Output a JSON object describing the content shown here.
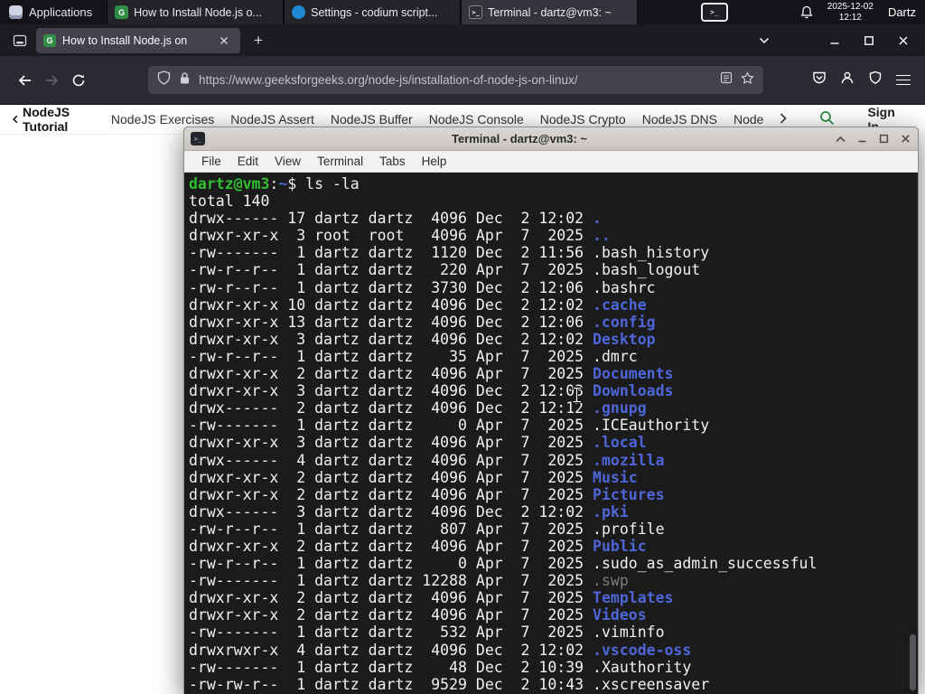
{
  "colors": {
    "panel_bg": "#141418",
    "tabstrip_bg": "#1c1b22",
    "navbar_bg": "#2b2a33",
    "urlbar_bg": "#42414d",
    "gfg_green": "#2f8d46",
    "term_bg": "#1b1b1b",
    "term_fg": "#f1f1f1",
    "term_green": "#2fbe2f",
    "term_blue": "#4e66d8",
    "term_dim": "#7d7d7d"
  },
  "taskbar": {
    "applications": "Applications",
    "windows": [
      {
        "title": "How to Install Node.js o...",
        "icon": "gfg",
        "active": false
      },
      {
        "title": "Settings - codium script...",
        "icon": "codium",
        "active": false
      },
      {
        "title": "Terminal - dartz@vm3: ~",
        "icon": "terminal",
        "active": true
      }
    ],
    "date": "2025-12-02",
    "time": "12:12",
    "user": "Dartz"
  },
  "icons": {
    "tray_terminal_glyph": ">_",
    "terminal_title_glyph": ">_",
    "gfg_glyph": "G",
    "new_tab_glyph": "+"
  },
  "browser": {
    "tab_title": "How to Install Node.js on",
    "url": "https://www.geeksforgeeks.org/node-js/installation-of-node-js-on-linux/",
    "site_nav": {
      "back_item": "NodeJS Tutorial",
      "items": [
        "NodeJS Exercises",
        "NodeJS Assert",
        "NodeJS Buffer",
        "NodeJS Console",
        "NodeJS Crypto",
        "NodeJS DNS",
        "Node"
      ],
      "sign_in": "Sign In"
    }
  },
  "terminal": {
    "window_title": "Terminal - dartz@vm3: ~",
    "menu": [
      "File",
      "Edit",
      "View",
      "Terminal",
      "Tabs",
      "Help"
    ],
    "prompt": {
      "user": "dartz@vm3",
      "sep": ":",
      "path": "~",
      "dollar": "$",
      "command": "ls -la"
    },
    "total_line": "total 140",
    "listing": [
      [
        "drwx------",
        "17",
        "dartz",
        "dartz",
        "4096",
        "Dec",
        "2",
        "12:02",
        ".",
        "dir"
      ],
      [
        "drwxr-xr-x",
        "3",
        "root",
        "root",
        "4096",
        "Apr",
        "7",
        "2025",
        "..",
        "dir"
      ],
      [
        "-rw-------",
        "1",
        "dartz",
        "dartz",
        "1120",
        "Dec",
        "2",
        "11:56",
        ".bash_history",
        "file"
      ],
      [
        "-rw-r--r--",
        "1",
        "dartz",
        "dartz",
        "220",
        "Apr",
        "7",
        "2025",
        ".bash_logout",
        "file"
      ],
      [
        "-rw-r--r--",
        "1",
        "dartz",
        "dartz",
        "3730",
        "Dec",
        "2",
        "12:06",
        ".bashrc",
        "file"
      ],
      [
        "drwxr-xr-x",
        "10",
        "dartz",
        "dartz",
        "4096",
        "Dec",
        "2",
        "12:02",
        ".cache",
        "dir"
      ],
      [
        "drwxr-xr-x",
        "13",
        "dartz",
        "dartz",
        "4096",
        "Dec",
        "2",
        "12:06",
        ".config",
        "dir"
      ],
      [
        "drwxr-xr-x",
        "3",
        "dartz",
        "dartz",
        "4096",
        "Dec",
        "2",
        "12:02",
        "Desktop",
        "dir"
      ],
      [
        "-rw-r--r--",
        "1",
        "dartz",
        "dartz",
        "35",
        "Apr",
        "7",
        "2025",
        ".dmrc",
        "file"
      ],
      [
        "drwxr-xr-x",
        "2",
        "dartz",
        "dartz",
        "4096",
        "Apr",
        "7",
        "2025",
        "Documents",
        "dir"
      ],
      [
        "drwxr-xr-x",
        "3",
        "dartz",
        "dartz",
        "4096",
        "Dec",
        "2",
        "12:03",
        "Downloads",
        "dir"
      ],
      [
        "drwx------",
        "2",
        "dartz",
        "dartz",
        "4096",
        "Dec",
        "2",
        "12:12",
        ".gnupg",
        "dir"
      ],
      [
        "-rw-------",
        "1",
        "dartz",
        "dartz",
        "0",
        "Apr",
        "7",
        "2025",
        ".ICEauthority",
        "file"
      ],
      [
        "drwxr-xr-x",
        "3",
        "dartz",
        "dartz",
        "4096",
        "Apr",
        "7",
        "2025",
        ".local",
        "dir"
      ],
      [
        "drwx------",
        "4",
        "dartz",
        "dartz",
        "4096",
        "Apr",
        "7",
        "2025",
        ".mozilla",
        "dir"
      ],
      [
        "drwxr-xr-x",
        "2",
        "dartz",
        "dartz",
        "4096",
        "Apr",
        "7",
        "2025",
        "Music",
        "dir"
      ],
      [
        "drwxr-xr-x",
        "2",
        "dartz",
        "dartz",
        "4096",
        "Apr",
        "7",
        "2025",
        "Pictures",
        "dir"
      ],
      [
        "drwx------",
        "3",
        "dartz",
        "dartz",
        "4096",
        "Dec",
        "2",
        "12:02",
        ".pki",
        "dir"
      ],
      [
        "-rw-r--r--",
        "1",
        "dartz",
        "dartz",
        "807",
        "Apr",
        "7",
        "2025",
        ".profile",
        "file"
      ],
      [
        "drwxr-xr-x",
        "2",
        "dartz",
        "dartz",
        "4096",
        "Apr",
        "7",
        "2025",
        "Public",
        "dir"
      ],
      [
        "-rw-r--r--",
        "1",
        "dartz",
        "dartz",
        "0",
        "Apr",
        "7",
        "2025",
        ".sudo_as_admin_successful",
        "file"
      ],
      [
        "-rw-------",
        "1",
        "dartz",
        "dartz",
        "12288",
        "Apr",
        "7",
        "2025",
        ".swp",
        "dim"
      ],
      [
        "drwxr-xr-x",
        "2",
        "dartz",
        "dartz",
        "4096",
        "Apr",
        "7",
        "2025",
        "Templates",
        "dir"
      ],
      [
        "drwxr-xr-x",
        "2",
        "dartz",
        "dartz",
        "4096",
        "Apr",
        "7",
        "2025",
        "Videos",
        "dir"
      ],
      [
        "-rw-------",
        "1",
        "dartz",
        "dartz",
        "532",
        "Apr",
        "7",
        "2025",
        ".viminfo",
        "file"
      ],
      [
        "drwxrwxr-x",
        "4",
        "dartz",
        "dartz",
        "4096",
        "Dec",
        "2",
        "12:02",
        ".vscode-oss",
        "dir"
      ],
      [
        "-rw-------",
        "1",
        "dartz",
        "dartz",
        "48",
        "Dec",
        "2",
        "10:39",
        ".Xauthority",
        "file"
      ],
      [
        "-rw-rw-r--",
        "1",
        "dartz",
        "dartz",
        "9529",
        "Dec",
        "2",
        "10:43",
        ".xscreensaver",
        "file"
      ]
    ]
  }
}
